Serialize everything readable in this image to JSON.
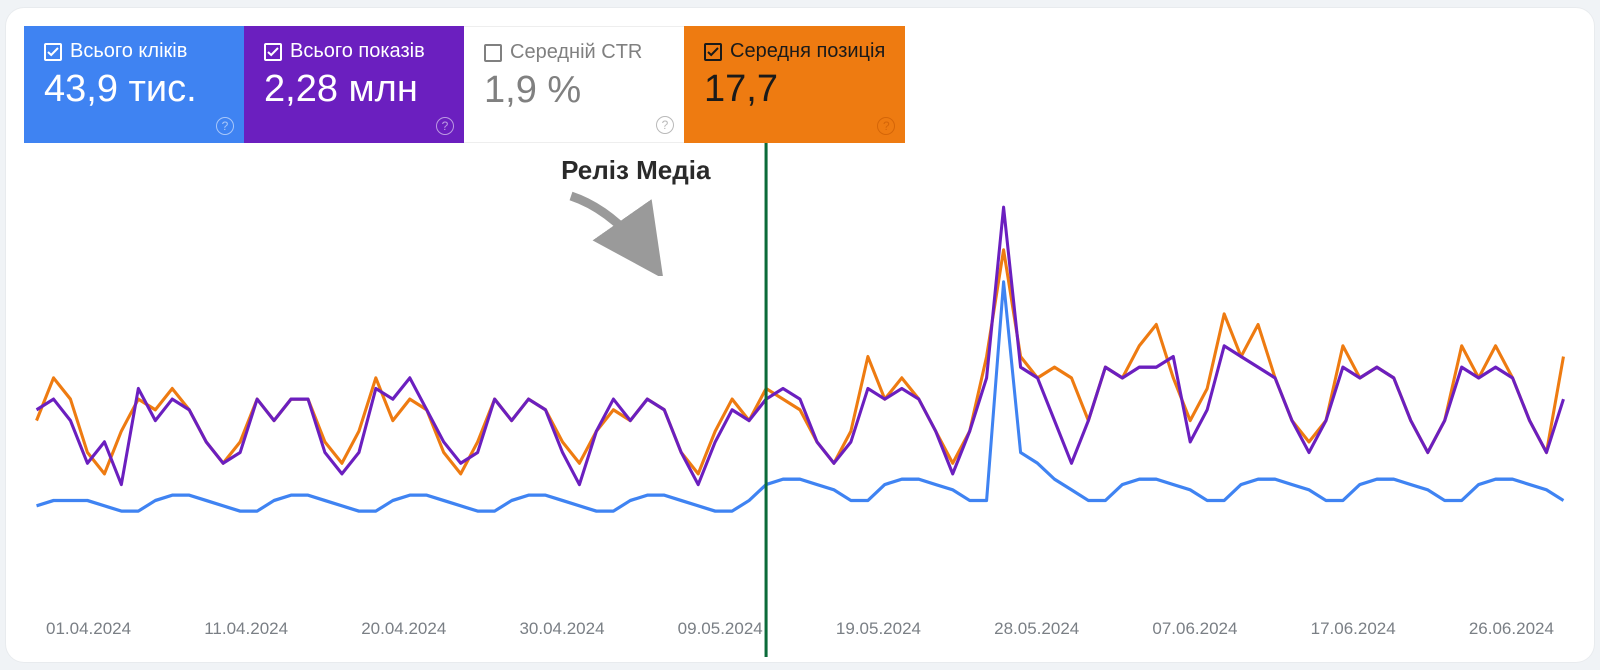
{
  "metrics": [
    {
      "id": "clicks",
      "label": "Всього кліків",
      "value": "43,9 тис.",
      "checked": true,
      "color": "blue"
    },
    {
      "id": "impressions",
      "label": "Всього показів",
      "value": "2,28 млн",
      "checked": true,
      "color": "purple"
    },
    {
      "id": "ctr",
      "label": "Середній CTR",
      "value": "1,9 %",
      "checked": false,
      "color": "white"
    },
    {
      "id": "position",
      "label": "Середня позиція",
      "value": "17,7",
      "checked": true,
      "color": "orange"
    }
  ],
  "annotation": {
    "text": "Реліз Медіа",
    "xindex": 43
  },
  "chart_data": {
    "type": "line",
    "xlabel": "",
    "ylabel": "",
    "x_tick_labels": [
      "01.04.2024",
      "11.04.2024",
      "20.04.2024",
      "30.04.2024",
      "09.05.2024",
      "19.05.2024",
      "28.05.2024",
      "07.06.2024",
      "17.06.2024",
      "26.06.2024"
    ],
    "colors": {
      "clicks": "#3f83f2",
      "impressions": "#6b1fbf",
      "position": "#ee7b11"
    },
    "series": [
      {
        "name": "clicks",
        "values": [
          14,
          15,
          15,
          15,
          14,
          13,
          13,
          15,
          16,
          16,
          15,
          14,
          13,
          13,
          15,
          16,
          16,
          15,
          14,
          13,
          13,
          15,
          16,
          16,
          15,
          14,
          13,
          13,
          15,
          16,
          16,
          15,
          14,
          13,
          13,
          15,
          16,
          16,
          15,
          14,
          13,
          13,
          15,
          18,
          19,
          19,
          18,
          17,
          15,
          15,
          18,
          19,
          19,
          18,
          17,
          15,
          15,
          56,
          24,
          22,
          19,
          17,
          15,
          15,
          18,
          19,
          19,
          18,
          17,
          15,
          15,
          18,
          19,
          19,
          18,
          17,
          15,
          15,
          18,
          19,
          19,
          18,
          17,
          15,
          15,
          18,
          19,
          19,
          18,
          17,
          15
        ]
      },
      {
        "name": "impressions",
        "values": [
          32,
          34,
          30,
          22,
          26,
          18,
          36,
          30,
          34,
          32,
          26,
          22,
          24,
          34,
          30,
          34,
          34,
          24,
          20,
          24,
          36,
          34,
          38,
          32,
          26,
          22,
          24,
          34,
          30,
          34,
          32,
          24,
          18,
          28,
          34,
          30,
          34,
          32,
          24,
          18,
          26,
          32,
          30,
          34,
          36,
          34,
          26,
          22,
          26,
          36,
          34,
          36,
          34,
          28,
          20,
          28,
          38,
          70,
          40,
          38,
          30,
          22,
          30,
          40,
          38,
          40,
          40,
          42,
          26,
          32,
          44,
          42,
          40,
          38,
          30,
          24,
          30,
          40,
          38,
          40,
          38,
          30,
          24,
          30,
          40,
          38,
          40,
          38,
          30,
          24,
          34
        ]
      },
      {
        "name": "position",
        "values": [
          30,
          38,
          34,
          24,
          20,
          28,
          34,
          32,
          36,
          32,
          26,
          22,
          26,
          34,
          30,
          34,
          34,
          26,
          22,
          28,
          38,
          30,
          34,
          32,
          24,
          20,
          26,
          34,
          30,
          34,
          32,
          26,
          22,
          28,
          32,
          30,
          34,
          32,
          24,
          20,
          28,
          34,
          30,
          36,
          34,
          32,
          26,
          22,
          28,
          42,
          34,
          38,
          34,
          28,
          22,
          28,
          42,
          62,
          42,
          38,
          40,
          38,
          30,
          40,
          38,
          44,
          48,
          38,
          30,
          36,
          50,
          42,
          48,
          38,
          30,
          26,
          30,
          44,
          38,
          40,
          38,
          30,
          24,
          30,
          44,
          38,
          44,
          38,
          30,
          24,
          42
        ]
      }
    ]
  }
}
